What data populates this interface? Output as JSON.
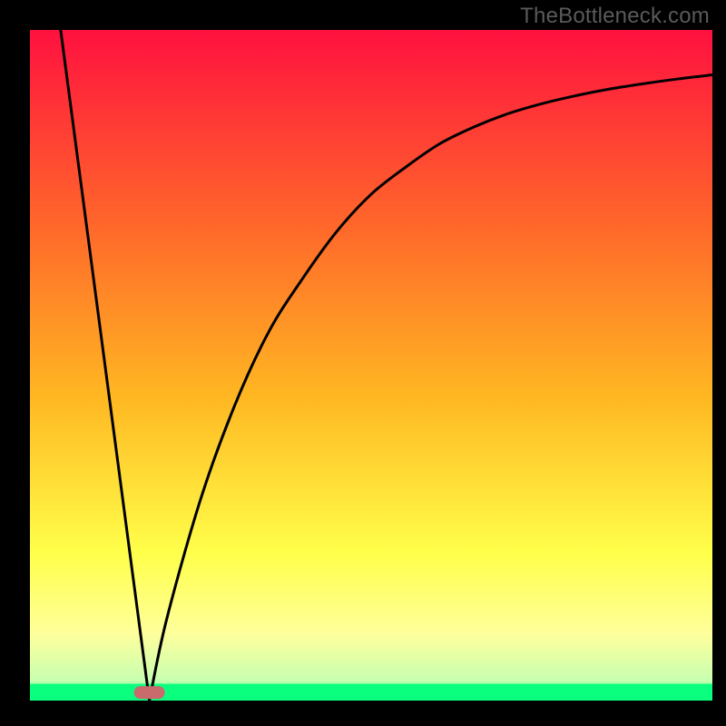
{
  "watermark": "TheBottleneck.com",
  "chart_data": {
    "type": "line",
    "title": "",
    "xlabel": "",
    "ylabel": "",
    "xlim": [
      0,
      100
    ],
    "ylim": [
      0,
      100
    ],
    "background_gradient": {
      "top": "#ff113f",
      "mid_upper": "#ff9e22",
      "mid": "#ffff4a",
      "mid_lower": "#ffff9c",
      "bottom": "#0bff7e"
    },
    "baseline_band": {
      "y_from": 0,
      "y_to": 2.5,
      "color": "#0bff7e"
    },
    "marker": {
      "x": 17.5,
      "y": 1.2,
      "color": "#c96a6d",
      "shape": "rounded-rect"
    },
    "series": [
      {
        "name": "left-descent",
        "x": [
          4.5,
          17.5
        ],
        "y": [
          100,
          0
        ],
        "note": "straight line from top-left down to the minimum"
      },
      {
        "name": "right-rise",
        "x": [
          17.5,
          20,
          25,
          30,
          35,
          40,
          45,
          50,
          55,
          60,
          65,
          70,
          75,
          80,
          85,
          90,
          95,
          100
        ],
        "y": [
          0,
          12,
          30,
          44,
          55,
          63,
          70,
          75.5,
          79.5,
          83,
          85.5,
          87.5,
          89,
          90.2,
          91.2,
          92,
          92.7,
          93.3
        ],
        "note": "concave saturating curve rising to the upper right"
      }
    ]
  }
}
